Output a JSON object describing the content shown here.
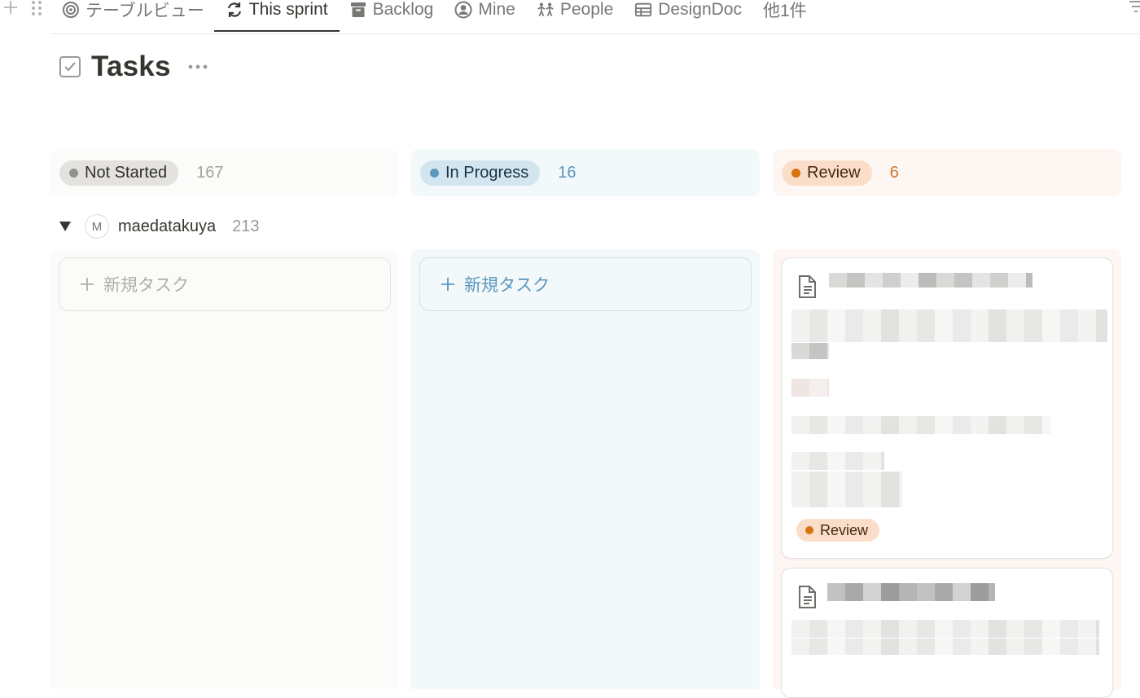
{
  "tabs": [
    {
      "label": "テーブルビュー",
      "icon": "target-icon",
      "active": false
    },
    {
      "label": "This sprint",
      "icon": "sync-icon",
      "active": true
    },
    {
      "label": "Backlog",
      "icon": "archive-box-icon",
      "active": false
    },
    {
      "label": "Mine",
      "icon": "user-circle-icon",
      "active": false
    },
    {
      "label": "People",
      "icon": "people-icon",
      "active": false
    },
    {
      "label": "DesignDoc",
      "icon": "table-icon",
      "active": false
    },
    {
      "label": "他1件",
      "icon": "",
      "active": false
    }
  ],
  "page": {
    "title": "Tasks"
  },
  "columns": {
    "not_started": {
      "label": "Not Started",
      "count": "167",
      "new_task": "新規タスク",
      "color": "#91918e"
    },
    "in_progress": {
      "label": "In Progress",
      "count": "16",
      "new_task": "新規タスク",
      "color": "#5b97bd"
    },
    "review": {
      "label": "Review",
      "count": "6",
      "color": "#d9730d"
    }
  },
  "group": {
    "avatar_letter": "M",
    "name": "maedatakuya",
    "count": "213"
  },
  "cards": [
    {
      "status": "Review"
    }
  ]
}
